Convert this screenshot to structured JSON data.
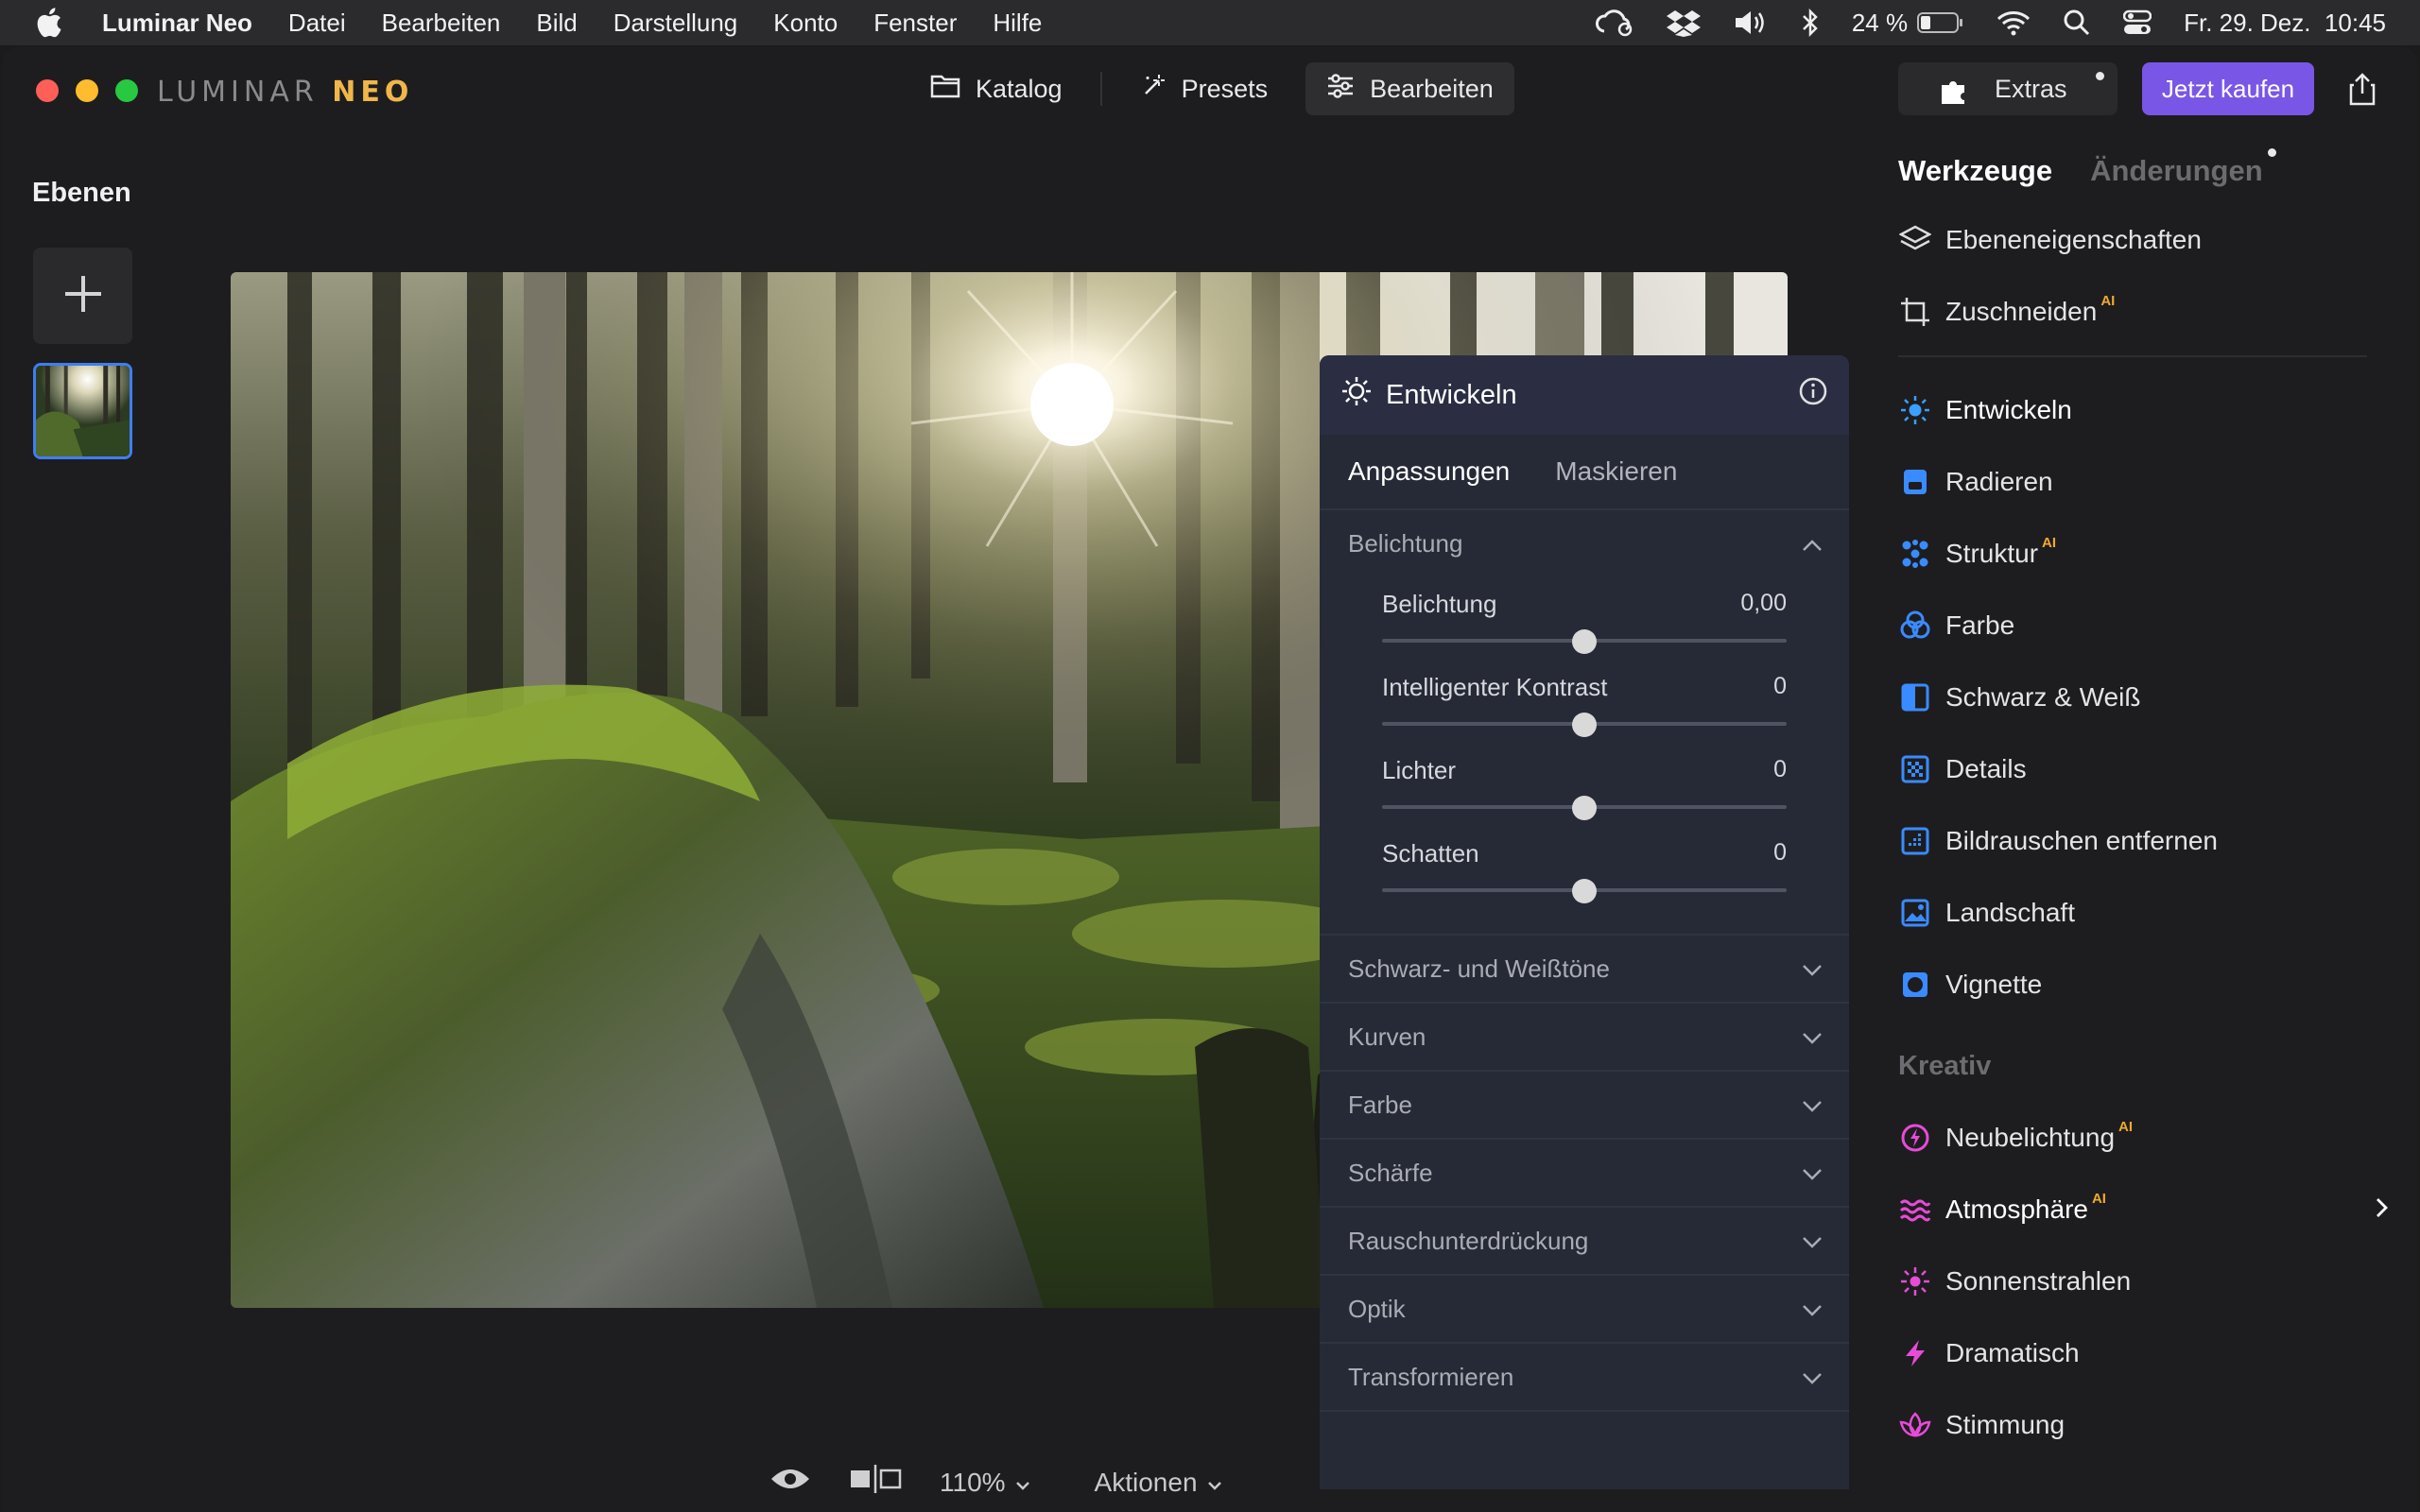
{
  "menubar": {
    "app": "Luminar Neo",
    "items": [
      "Datei",
      "Bearbeiten",
      "Bild",
      "Darstellung",
      "Konto",
      "Fenster",
      "Hilfe"
    ],
    "battery": "24 %",
    "datetime": "Fr. 29. Dez.  10:45"
  },
  "window": {
    "logo_part1": "LUMINAR",
    "logo_part2": "NEO",
    "modes": {
      "catalog": "Katalog",
      "presets": "Presets",
      "edit": "Bearbeiten"
    },
    "extras_label": "Extras",
    "buy_label": "Jetzt kaufen"
  },
  "layers": {
    "title": "Ebenen"
  },
  "bottombar": {
    "zoom": "110%",
    "actions": "Aktionen"
  },
  "develop": {
    "title": "Entwickeln",
    "tabs": [
      "Anpassungen",
      "Maskieren"
    ],
    "open_section": "Belichtung",
    "sliders": [
      {
        "label": "Belichtung",
        "value": "0,00",
        "level": 0.5
      },
      {
        "label": "Intelligenter Kontrast",
        "value": "0",
        "level": 0.5
      },
      {
        "label": "Lichter",
        "value": "0",
        "level": 0.5
      },
      {
        "label": "Schatten",
        "value": "0",
        "level": 0.5
      }
    ],
    "sections": [
      "Schwarz- und Weißtöne",
      "Kurven",
      "Farbe",
      "Schärfe",
      "Rauschunterdrückung",
      "Optik",
      "Transformieren"
    ]
  },
  "tools": {
    "tab_tools": "Werkzeuge",
    "tab_changes": "Änderungen",
    "top": [
      {
        "label": "Ebeneneigenschaften",
        "icon": "layers-icon"
      },
      {
        "label": "Zuschneiden",
        "icon": "crop-icon",
        "ai": "AI"
      }
    ],
    "essentials": [
      {
        "label": "Entwickeln",
        "icon": "sun-icon",
        "color": "#3aa0ff"
      },
      {
        "label": "Radieren",
        "icon": "eraser-icon",
        "color": "#3a8bff"
      },
      {
        "label": "Struktur",
        "icon": "structure-icon",
        "color": "#3a8bff",
        "ai": "AI"
      },
      {
        "label": "Farbe",
        "icon": "color-icon",
        "color": "#3a8bff"
      },
      {
        "label": "Schwarz & Weiß",
        "icon": "bw-icon",
        "color": "#3a8bff"
      },
      {
        "label": "Details",
        "icon": "details-icon",
        "color": "#3a8bff"
      },
      {
        "label": "Bildrauschen entfernen",
        "icon": "denoise-icon",
        "color": "#3a8bff"
      },
      {
        "label": "Landschaft",
        "icon": "landscape-icon",
        "color": "#3a8bff"
      },
      {
        "label": "Vignette",
        "icon": "vignette-icon",
        "color": "#3a8bff"
      }
    ],
    "creative_label": "Kreativ",
    "creative": [
      {
        "label": "Neubelichtung",
        "icon": "relight-icon",
        "color": "#e84bd8",
        "ai": "AI"
      },
      {
        "label": "Atmosphäre",
        "icon": "atmosphere-icon",
        "color": "#e84bd8",
        "ai": "AI"
      },
      {
        "label": "Sonnenstrahlen",
        "icon": "sunrays-icon",
        "color": "#e84bd8"
      },
      {
        "label": "Dramatisch",
        "icon": "dramatic-icon",
        "color": "#e84bd8"
      },
      {
        "label": "Stimmung",
        "icon": "mood-icon",
        "color": "#e84bd8"
      }
    ]
  }
}
